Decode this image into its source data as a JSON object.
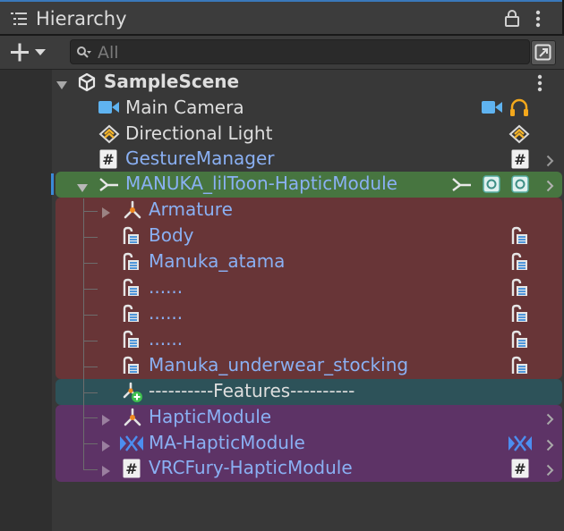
{
  "window": {
    "tab_title": "Hierarchy",
    "tab_icon": "hierarchy-list-icon"
  },
  "toolbar": {
    "add_icon": "plus-dropdown-icon",
    "search_placeholder": "All",
    "search_icon": "search-icon",
    "pick_icon": "scene-pick-icon"
  },
  "colors": {
    "selected_row": "#477540",
    "group_red": "#683537",
    "group_teal": "#2d5259",
    "group_purple": "#5d3366",
    "prefab_text": "#8ab0f3",
    "selection_marker": "#3a8ad8"
  },
  "tree": {
    "scene": {
      "label": "SampleScene",
      "icon": "unity-scene-icon",
      "menu_icon": "kebab-menu-icon"
    },
    "rows": [
      {
        "label": "Main Camera",
        "icon": "camera-icon",
        "right_icons": [
          "camera-icon",
          "audio-listener-icon"
        ]
      },
      {
        "label": "Directional Light",
        "icon": "light-icon",
        "right_icons": [
          "light-icon"
        ]
      },
      {
        "label": "GestureManager",
        "icon": "script-icon",
        "right_icons": [
          "script-icon"
        ]
      },
      {
        "label": "MANUKA_lilToon-HapticModule",
        "icon": "avatar-root-icon",
        "right_icons": [
          "avatar-root-icon",
          "component-icon",
          "component-icon"
        ]
      },
      {
        "label": "Armature",
        "icon": "armature-icon"
      },
      {
        "label": "Body",
        "icon": "skinned-mesh-icon"
      },
      {
        "label": "Manuka_atama",
        "icon": "skinned-mesh-icon"
      },
      {
        "label": "......",
        "icon": "skinned-mesh-icon"
      },
      {
        "label": "......",
        "icon": "skinned-mesh-icon"
      },
      {
        "label": "......",
        "icon": "skinned-mesh-icon"
      },
      {
        "label": "Manuka_underwear_stocking",
        "icon": "skinned-mesh-icon"
      },
      {
        "label": "----------Features----------",
        "icon": "armature-add-icon"
      },
      {
        "label": "HapticModule",
        "icon": "armature-icon"
      },
      {
        "label": "MA-HapticModule",
        "icon": "modular-avatar-icon",
        "right_icons": [
          "modular-avatar-icon"
        ]
      },
      {
        "label": "VRCFury-HapticModule",
        "icon": "script-icon",
        "right_icons": [
          "script-icon"
        ]
      }
    ]
  }
}
